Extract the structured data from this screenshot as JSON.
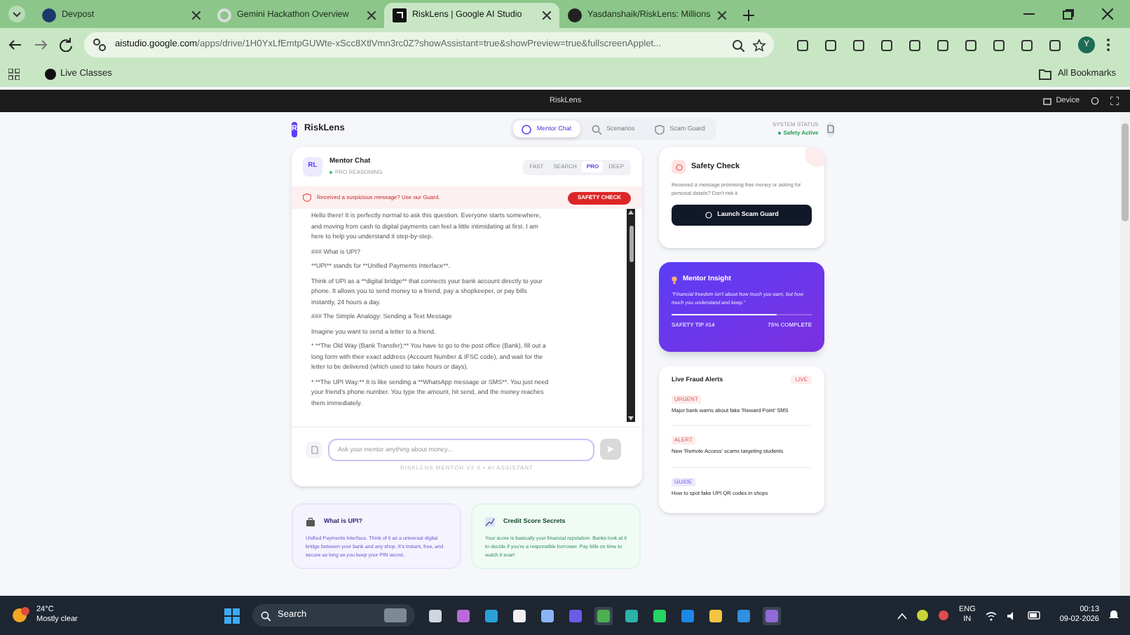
{
  "browser": {
    "tabs": [
      {
        "title": "Devpost",
        "selected": false
      },
      {
        "title": "Gemini Hackathon Overview",
        "selected": false
      },
      {
        "title": "RiskLens | Google AI Studio",
        "selected": true
      },
      {
        "title": "Yasdanshaik/RiskLens: Millions",
        "selected": false
      }
    ],
    "url_host": "aistudio.google.com",
    "url_path": "/apps/drive/1H0YxLfEmtpGUWte-xScc8XtlVmn3rc0Z?showAssistant=true&showPreview=true&fullscreenApplet...",
    "profile": "Y",
    "bookmarks": [
      "Live Classes"
    ],
    "all_bookmarks": "All Bookmarks"
  },
  "preview_bar": {
    "title": "RiskLens",
    "device": "Device"
  },
  "app": {
    "logo": "R",
    "brand": "RiskLens",
    "nav": [
      {
        "label": "Mentor Chat",
        "selected": true
      },
      {
        "label": "Scenarios",
        "selected": false
      },
      {
        "label": "Scam Guard",
        "selected": false
      }
    ],
    "status_label": "SYSTEM STATUS",
    "status": "Safety Active",
    "chat": {
      "avatar": "RL",
      "title": "Mentor Chat",
      "subtitle": "PRO REASONING",
      "modes": [
        {
          "label": "FAST",
          "selected": false
        },
        {
          "label": "SEARCH",
          "selected": false
        },
        {
          "label": "PRO",
          "selected": true
        },
        {
          "label": "DEEP",
          "selected": false
        }
      ],
      "alert": "Received a suspicious message? Use our Guard.",
      "alert_button": "SAFETY CHECK",
      "messages": [
        "Hello there! It is perfectly normal to ask this question. Everyone starts somewhere, and moving from cash to digital payments can feel a little intimidating at first. I am here to help you understand it step-by-step.",
        "### What is UPI?",
        "**UPI** stands for **Unified Payments Interface**.",
        "Think of UPI as a **digital bridge** that connects your bank account directly to your phone. It allows you to send money to a friend, pay a shopkeeper, or pay bills instantly, 24 hours a day.",
        "### The Simple Analogy: Sending a Text Message",
        "Imagine you want to send a letter to a friend.",
        "* **The Old Way (Bank Transfer):** You have to go to the post office (Bank), fill out a long form with their exact address (Account Number & IFSC code), and wait for the letter to be delivered (which used to take hours or days).",
        "* **The UPI Way:** It is like sending a **WhatsApp message or SMS**. You just need your friend's phone number. You type the amount, hit send, and the money reaches them immediately."
      ],
      "placeholder": "Ask your mentor anything about money...",
      "footer": "RISKLENS MENTOR V2.0 • AI ASSISTANT"
    },
    "safety_check": {
      "title": "Safety Check",
      "text": "Received a message promising free money or asking for personal details? Don't risk it.",
      "button": "Launch Scam Guard"
    },
    "insight": {
      "title": "Mentor Insight",
      "quote": "\"Financial freedom isn't about how much you earn, but how much you understand and keep.\"",
      "level": 0.75,
      "tip": "SAFETY TIP #14",
      "progress": "75% COMPLETE"
    },
    "alerts": {
      "title": "Live Fraud Alerts",
      "badge": "LIVE",
      "items": [
        {
          "tag": "URGENT",
          "kind": "urgent",
          "text": "Major bank warns about fake 'Reward Point' SMS"
        },
        {
          "tag": "ALERT",
          "kind": "alert",
          "text": "New 'Remote Access' scams targeting students"
        },
        {
          "tag": "GUIDE",
          "kind": "guide",
          "text": "How to spot fake UPI QR codes in shops"
        }
      ]
    },
    "cards": [
      {
        "kind": "purple",
        "title": "What is UPI?",
        "text": "Unified Payments Interface. Think of it as a universal digital bridge between your bank and any shop. It's instant, free, and secure as long as you keep your PIN secret."
      },
      {
        "kind": "green",
        "title": "Credit Score Secrets",
        "text": "Your score is basically your financial reputation. Banks look at it to decide if you're a responsible borrower. Pay bills on time to watch it soar!"
      }
    ]
  },
  "taskbar": {
    "temperature": "24°C",
    "weather": "Mostly clear",
    "search": "Search",
    "lang": "ENG",
    "region": "IN",
    "time": "00:13",
    "date": "09-02-2026"
  }
}
